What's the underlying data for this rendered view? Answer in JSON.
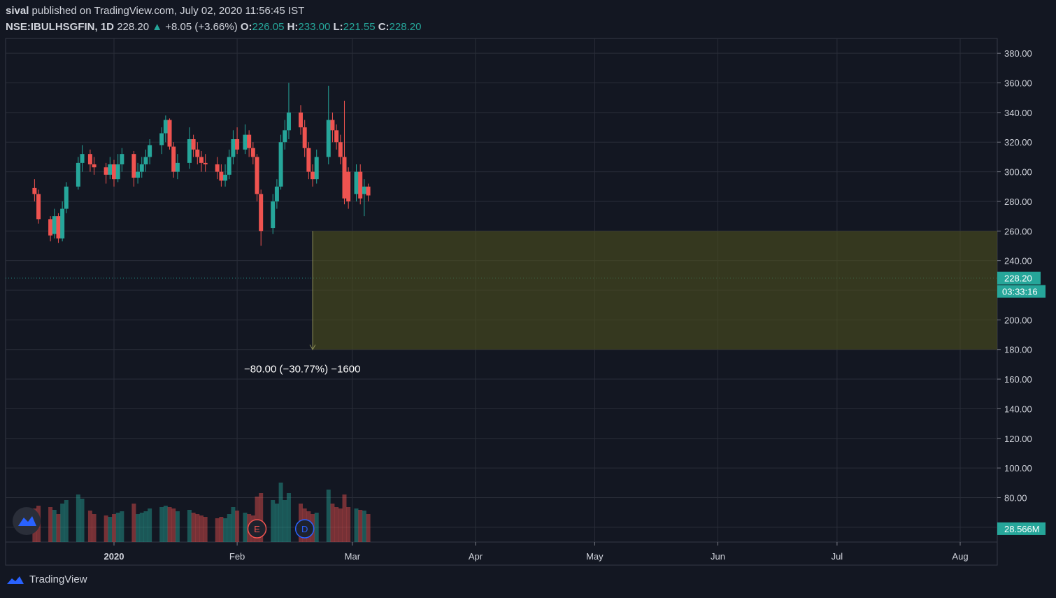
{
  "header": {
    "author": "sival",
    "published_text": "published on TradingView.com, July 02, 2020 11:56:45 IST",
    "symbol": "NSE:IBULHSGFIN, 1D",
    "last": "228.20",
    "change": "+8.05 (+3.66%)",
    "open_label": "O:",
    "open": "226.05",
    "high_label": "H:",
    "high": "233.00",
    "low_label": "L:",
    "low": "221.55",
    "close_label": "C:",
    "close": "228.20"
  },
  "footer": {
    "brand": "TradingView"
  },
  "colors": {
    "up": "#26a69a",
    "down": "#ef5350",
    "background": "#131722",
    "grid": "#2a2e39",
    "zone": "#4d4f1e"
  },
  "chart_data": {
    "type": "candlestick",
    "ylim": [
      50,
      390
    ],
    "y_ticks": [
      "380.00",
      "360.00",
      "340.00",
      "320.00",
      "300.00",
      "280.00",
      "260.00",
      "240.00",
      "220.00",
      "200.00",
      "180.00",
      "160.00",
      "140.00",
      "120.00",
      "100.00",
      "80.00",
      "60.00"
    ],
    "x_ticks": [
      {
        "label": "2020",
        "date": "2020-01-01"
      },
      {
        "label": "Feb",
        "date": "2020-02-01"
      },
      {
        "label": "Mar",
        "date": "2020-03-01"
      },
      {
        "label": "Apr",
        "date": "2020-04-01"
      },
      {
        "label": "May",
        "date": "2020-05-01"
      },
      {
        "label": "Jun",
        "date": "2020-06-01"
      },
      {
        "label": "Jul",
        "date": "2020-07-01"
      },
      {
        "label": "Aug",
        "date": "2020-08-01"
      }
    ],
    "price_tag": "228.20",
    "countdown": "03:33:16",
    "volume_tag": "28.566M",
    "last_price": 228.2,
    "measure_zone": {
      "from": 260,
      "to": 180,
      "start_date": "2020-02-20",
      "label": "−80.00 (−30.77%) −1600"
    },
    "markers": [
      {
        "label": "E",
        "date": "2020-02-06"
      },
      {
        "label": "D",
        "date": "2020-02-18"
      }
    ],
    "candles": [
      [
        "2019-12-12",
        289,
        285,
        295,
        280,
        48
      ],
      [
        "2019-12-13",
        285,
        268,
        288,
        265,
        52
      ],
      [
        "2019-12-16",
        268,
        257,
        270,
        253,
        50
      ],
      [
        "2019-12-17",
        258,
        270,
        275,
        255,
        46
      ],
      [
        "2019-12-18",
        270,
        255,
        272,
        252,
        40
      ],
      [
        "2019-12-19",
        255,
        275,
        280,
        253,
        55
      ],
      [
        "2019-12-20",
        275,
        290,
        293,
        272,
        60
      ],
      [
        "2019-12-23",
        290,
        306,
        310,
        288,
        68
      ],
      [
        "2019-12-24",
        306,
        312,
        318,
        300,
        62
      ],
      [
        "2019-12-26",
        312,
        305,
        315,
        300,
        45
      ],
      [
        "2019-12-27",
        305,
        303,
        310,
        298,
        40
      ],
      [
        "2019-12-30",
        303,
        298,
        306,
        292,
        38
      ],
      [
        "2019-12-31",
        298,
        305,
        310,
        295,
        36
      ],
      [
        "2020-01-01",
        305,
        295,
        308,
        290,
        40
      ],
      [
        "2020-01-02",
        295,
        305,
        312,
        293,
        42
      ],
      [
        "2020-01-03",
        305,
        312,
        316,
        300,
        44
      ],
      [
        "2020-01-06",
        312,
        296,
        314,
        290,
        55
      ],
      [
        "2020-01-07",
        296,
        300,
        306,
        292,
        40
      ],
      [
        "2020-01-08",
        300,
        305,
        310,
        296,
        42
      ],
      [
        "2020-01-09",
        305,
        310,
        315,
        300,
        44
      ],
      [
        "2020-01-10",
        310,
        318,
        322,
        305,
        48
      ],
      [
        "2020-01-13",
        318,
        326,
        330,
        312,
        50
      ],
      [
        "2020-01-14",
        326,
        335,
        338,
        320,
        52
      ],
      [
        "2020-01-15",
        335,
        317,
        336,
        315,
        50
      ],
      [
        "2020-01-16",
        317,
        300,
        320,
        296,
        48
      ],
      [
        "2020-01-17",
        300,
        306,
        312,
        295,
        44
      ],
      [
        "2020-01-20",
        306,
        322,
        330,
        302,
        46
      ],
      [
        "2020-01-21",
        322,
        315,
        325,
        310,
        42
      ],
      [
        "2020-01-22",
        315,
        310,
        320,
        305,
        40
      ],
      [
        "2020-01-23",
        310,
        306,
        314,
        300,
        38
      ],
      [
        "2020-01-24",
        306,
        305,
        312,
        300,
        36
      ],
      [
        "2020-01-27",
        305,
        300,
        310,
        295,
        34
      ],
      [
        "2020-01-28",
        300,
        294,
        305,
        290,
        36
      ],
      [
        "2020-01-29",
        294,
        298,
        305,
        290,
        34
      ],
      [
        "2020-01-30",
        298,
        310,
        315,
        295,
        40
      ],
      [
        "2020-01-31",
        310,
        322,
        328,
        305,
        50
      ],
      [
        "2020-02-01",
        322,
        315,
        330,
        312,
        45
      ],
      [
        "2020-02-03",
        315,
        325,
        332,
        312,
        42
      ],
      [
        "2020-02-04",
        325,
        316,
        328,
        310,
        40
      ],
      [
        "2020-02-05",
        316,
        310,
        320,
        305,
        38
      ],
      [
        "2020-02-06",
        310,
        285,
        312,
        280,
        65
      ],
      [
        "2020-02-07",
        285,
        260,
        288,
        250,
        70
      ],
      [
        "2020-02-10",
        262,
        280,
        285,
        258,
        60
      ],
      [
        "2020-02-11",
        280,
        290,
        295,
        275,
        55
      ],
      [
        "2020-02-12",
        290,
        320,
        325,
        288,
        85
      ],
      [
        "2020-02-13",
        320,
        328,
        335,
        315,
        60
      ],
      [
        "2020-02-14",
        328,
        340,
        360,
        322,
        70
      ],
      [
        "2020-02-17",
        340,
        330,
        345,
        325,
        55
      ],
      [
        "2020-02-18",
        330,
        316,
        335,
        310,
        48
      ],
      [
        "2020-02-19",
        316,
        300,
        320,
        295,
        44
      ],
      [
        "2020-02-20",
        300,
        295,
        305,
        290,
        40
      ],
      [
        "2020-02-21",
        295,
        310,
        315,
        292,
        42
      ],
      [
        "2020-02-24",
        310,
        335,
        358,
        305,
        75
      ],
      [
        "2020-02-25",
        335,
        328,
        340,
        320,
        55
      ],
      [
        "2020-02-26",
        328,
        320,
        332,
        315,
        50
      ],
      [
        "2020-02-27",
        320,
        310,
        325,
        305,
        48
      ],
      [
        "2020-02-28",
        310,
        282,
        348,
        278,
        68
      ],
      [
        "2020-02-29",
        300,
        280,
        303,
        275,
        50
      ],
      [
        "2020-03-02",
        285,
        300,
        305,
        280,
        48
      ],
      [
        "2020-03-03",
        300,
        282,
        305,
        278,
        46
      ],
      [
        "2020-03-04",
        285,
        290,
        295,
        270,
        45
      ],
      [
        "2020-03-05",
        290,
        284,
        292,
        280,
        40
      ]
    ]
  }
}
